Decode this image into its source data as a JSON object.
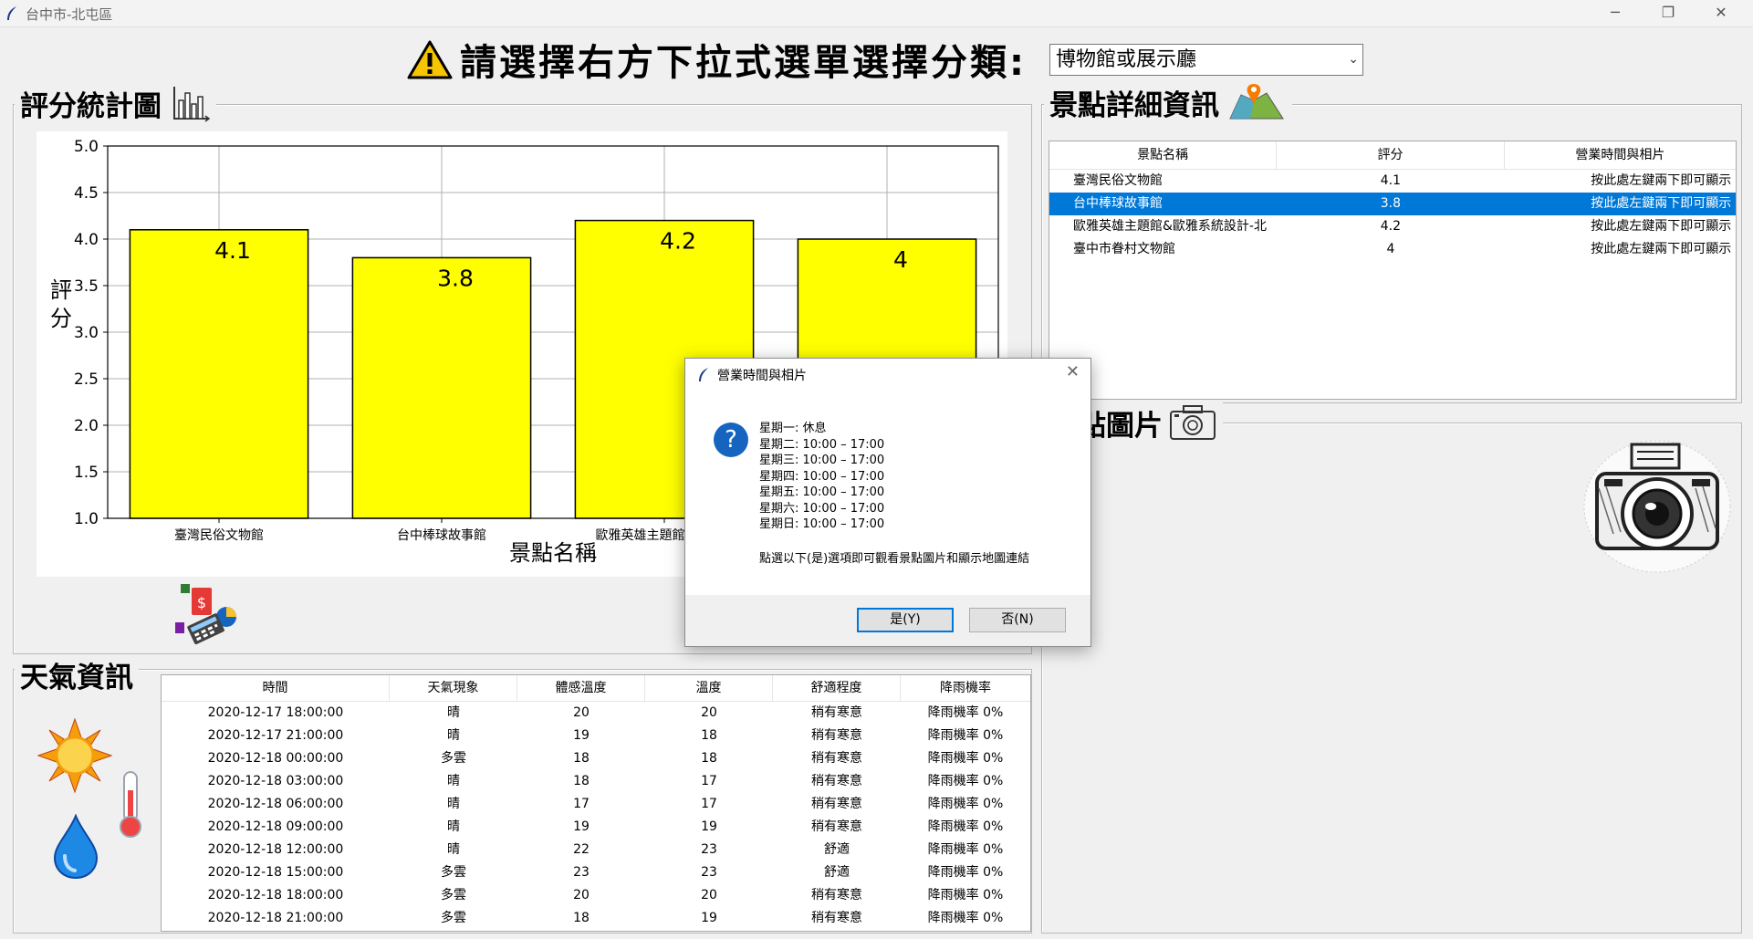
{
  "window": {
    "title": "台中市-北屯區",
    "controls": {
      "minimize": "─",
      "restore": "❐",
      "close": "✕"
    }
  },
  "header": {
    "prompt": "請選擇右方下拉式選單選擇分類:",
    "selected_category": "博物館或展示廳"
  },
  "chart_panel": {
    "title": "評分統計圖"
  },
  "chart_data": {
    "type": "bar",
    "categories": [
      "臺灣民俗文物館",
      "台中棒球故事館",
      "歐雅英雄主題館&歐雅系",
      "臺中市眷村文物館"
    ],
    "values": [
      4.1,
      3.8,
      4.2,
      4
    ],
    "data_labels": [
      "4.1",
      "3.8",
      "4.2",
      "4"
    ],
    "xlabel": "景點名稱",
    "ylabel": "評分",
    "ylim": [
      1.0,
      5.0
    ],
    "yticks": [
      "1.0",
      "1.5",
      "2.0",
      "2.5",
      "3.0",
      "3.5",
      "4.0",
      "4.5",
      "5.0"
    ],
    "grid": true,
    "bar_color": "#ffff00"
  },
  "details_panel": {
    "title": "景點詳細資訊",
    "columns": [
      "景點名稱",
      "評分",
      "營業時間與相片"
    ],
    "rows": [
      {
        "name": "臺灣民俗文物館",
        "score": "4.1",
        "hours": "按此處左鍵兩下即可顯示"
      },
      {
        "name": "台中棒球故事館",
        "score": "3.8",
        "hours": "按此處左鍵兩下即可顯示"
      },
      {
        "name": "歐雅英雄主題館&歐雅系統設計-北",
        "score": "4.2",
        "hours": "按此處左鍵兩下即可顯示"
      },
      {
        "name": "臺中市眷村文物館",
        "score": "4",
        "hours": "按此處左鍵兩下即可顯示"
      }
    ],
    "selected_index": 1
  },
  "photo_panel": {
    "title": "景點圖片"
  },
  "weather_panel": {
    "title": "天氣資訊",
    "columns": [
      "時間",
      "天氣現象",
      "體感溫度",
      "溫度",
      "舒適程度",
      "降雨機率"
    ],
    "rows": [
      [
        "2020-12-17 18:00:00",
        "晴",
        "20",
        "20",
        "稍有寒意",
        "降雨機率 0%"
      ],
      [
        "2020-12-17 21:00:00",
        "晴",
        "19",
        "18",
        "稍有寒意",
        "降雨機率 0%"
      ],
      [
        "2020-12-18 00:00:00",
        "多雲",
        "18",
        "18",
        "稍有寒意",
        "降雨機率 0%"
      ],
      [
        "2020-12-18 03:00:00",
        "晴",
        "18",
        "17",
        "稍有寒意",
        "降雨機率 0%"
      ],
      [
        "2020-12-18 06:00:00",
        "晴",
        "17",
        "17",
        "稍有寒意",
        "降雨機率 0%"
      ],
      [
        "2020-12-18 09:00:00",
        "晴",
        "19",
        "19",
        "稍有寒意",
        "降雨機率 0%"
      ],
      [
        "2020-12-18 12:00:00",
        "晴",
        "22",
        "23",
        "舒適",
        "降雨機率 0%"
      ],
      [
        "2020-12-18 15:00:00",
        "多雲",
        "23",
        "23",
        "舒適",
        "降雨機率 0%"
      ],
      [
        "2020-12-18 18:00:00",
        "多雲",
        "20",
        "20",
        "稍有寒意",
        "降雨機率 0%"
      ],
      [
        "2020-12-18 21:00:00",
        "多雲",
        "18",
        "19",
        "稍有寒意",
        "降雨機率 0%"
      ]
    ]
  },
  "dialog": {
    "title": "營業時間與相片",
    "hours": [
      "星期一: 休息",
      "星期二: 10:00 – 17:00",
      "星期三: 10:00 – 17:00",
      "星期四: 10:00 – 17:00",
      "星期五: 10:00 – 17:00",
      "星期六: 10:00 – 17:00",
      "星期日: 10:00 – 17:00"
    ],
    "message": "點選以下(是)選項即可觀看景點圖片和顯示地圖連結",
    "yes_label": "是(Y)",
    "no_label": "否(N)",
    "question_glyph": "?"
  }
}
